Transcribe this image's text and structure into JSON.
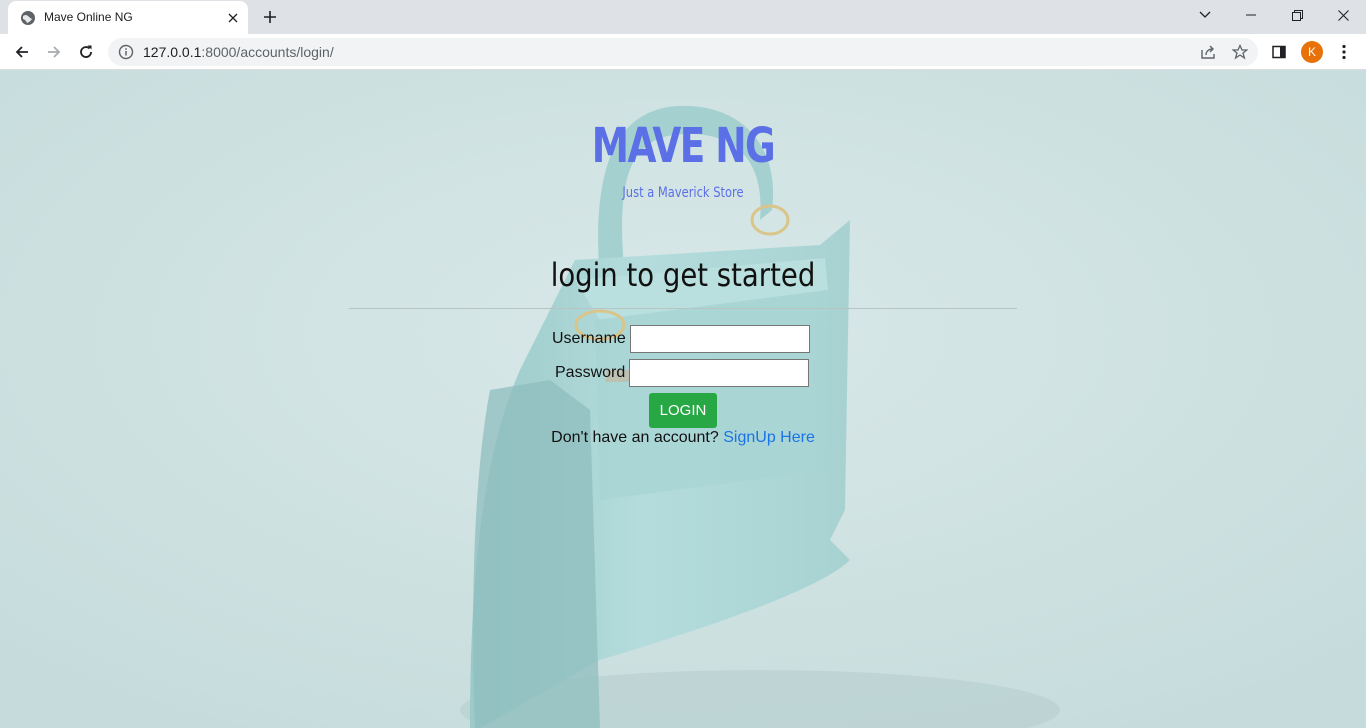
{
  "browser": {
    "tab_title": "Mave Online NG",
    "tab_close": "✕",
    "new_tab": "+",
    "url_host": "127.0.0.1",
    "url_rest": ":8000/accounts/login/",
    "profile_initial": "K"
  },
  "page": {
    "brand": "MAVE NG",
    "tagline": "Just a Maverick Store",
    "heading": "login to get started",
    "form": {
      "username_label": "Username",
      "password_label": "Password",
      "username_value": "",
      "password_value": "",
      "submit_label": "LOGIN"
    },
    "signup": {
      "prompt": "Don't have an account?",
      "link_label": "SignUp Here"
    }
  },
  "colors": {
    "brand": "#5b6fe6",
    "login_button": "#28a745",
    "link": "#1a73e8"
  }
}
